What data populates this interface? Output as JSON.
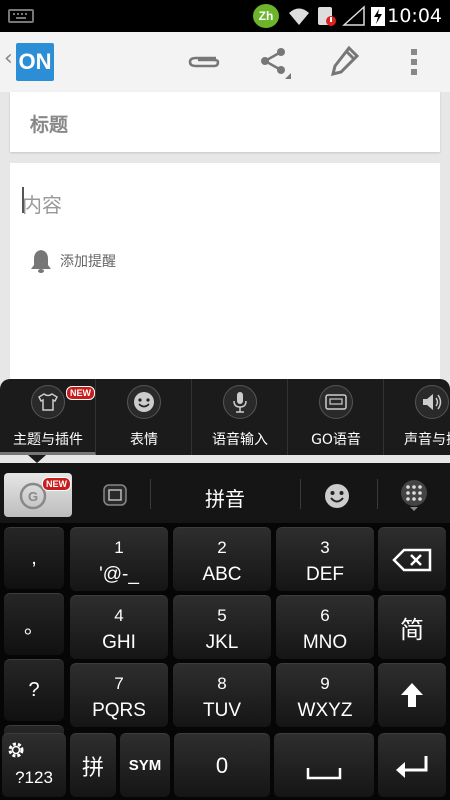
{
  "status_bar": {
    "ime_badge": "Zh",
    "time": "10:04"
  },
  "toolbar": {
    "app_logo_text": "ON"
  },
  "editor": {
    "title_placeholder": "标题",
    "content_placeholder": "内容",
    "reminder_label": "添加提醒"
  },
  "ime_plugins": {
    "new_badge": "NEW",
    "items": [
      {
        "label": "主题与插件",
        "icon": "shirt-icon"
      },
      {
        "label": "表情",
        "icon": "smiley-icon"
      },
      {
        "label": "语音输入",
        "icon": "microphone-icon"
      },
      {
        "label": "GO语音",
        "icon": "tape-icon"
      },
      {
        "label": "声音与振",
        "icon": "speaker-icon"
      }
    ]
  },
  "candidate_bar": {
    "new_badge": "NEW",
    "mode_label": "拼音"
  },
  "keyboard": {
    "punct_keys": [
      ",",
      "。",
      "?",
      "!"
    ],
    "num_keys": [
      {
        "num": "1",
        "letters": "'@-_"
      },
      {
        "num": "2",
        "letters": "ABC"
      },
      {
        "num": "3",
        "letters": "DEF"
      },
      {
        "num": "4",
        "letters": "GHI"
      },
      {
        "num": "5",
        "letters": "JKL"
      },
      {
        "num": "6",
        "letters": "MNO"
      },
      {
        "num": "7",
        "letters": "PQRS"
      },
      {
        "num": "8",
        "letters": "TUV"
      },
      {
        "num": "9",
        "letters": "WXYZ"
      }
    ],
    "simplified_label": "简",
    "switch_label": "?123",
    "pinyin_label": "拼",
    "sym_label": "SYM",
    "zero_label": "0"
  }
}
